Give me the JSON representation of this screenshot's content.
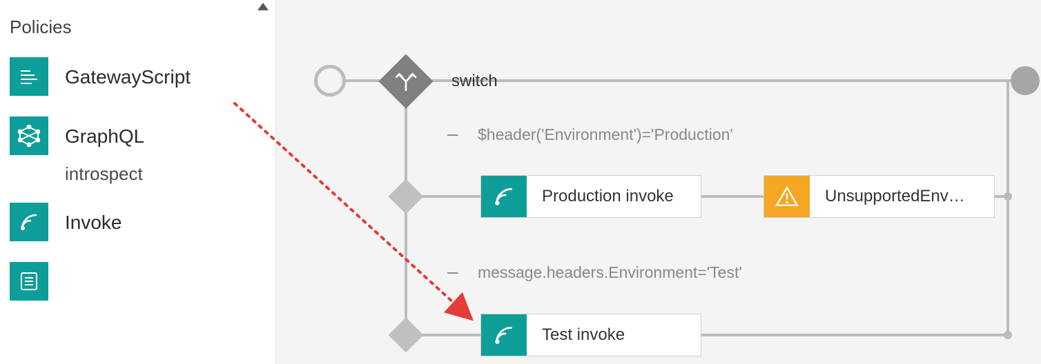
{
  "sidebar": {
    "title": "Policies",
    "items": [
      {
        "label": "GatewayScript",
        "icon": "script-icon"
      },
      {
        "label": "GraphQL",
        "icon": "graphql-icon",
        "sub": "introspect"
      },
      {
        "label": "Invoke",
        "icon": "invoke-icon"
      },
      {
        "label": "",
        "icon": "list-icon"
      }
    ]
  },
  "flow": {
    "switch_label": "switch",
    "branches": [
      {
        "condition": "$header('Environment')='Production'",
        "nodes": [
          {
            "label": "Production invoke",
            "kind": "invoke",
            "color": "teal"
          },
          {
            "label": "UnsupportedEnv…",
            "kind": "throw",
            "color": "orange"
          }
        ]
      },
      {
        "condition": "message.headers.Environment='Test'",
        "nodes": [
          {
            "label": "Test invoke",
            "kind": "invoke",
            "color": "teal"
          }
        ]
      }
    ]
  }
}
